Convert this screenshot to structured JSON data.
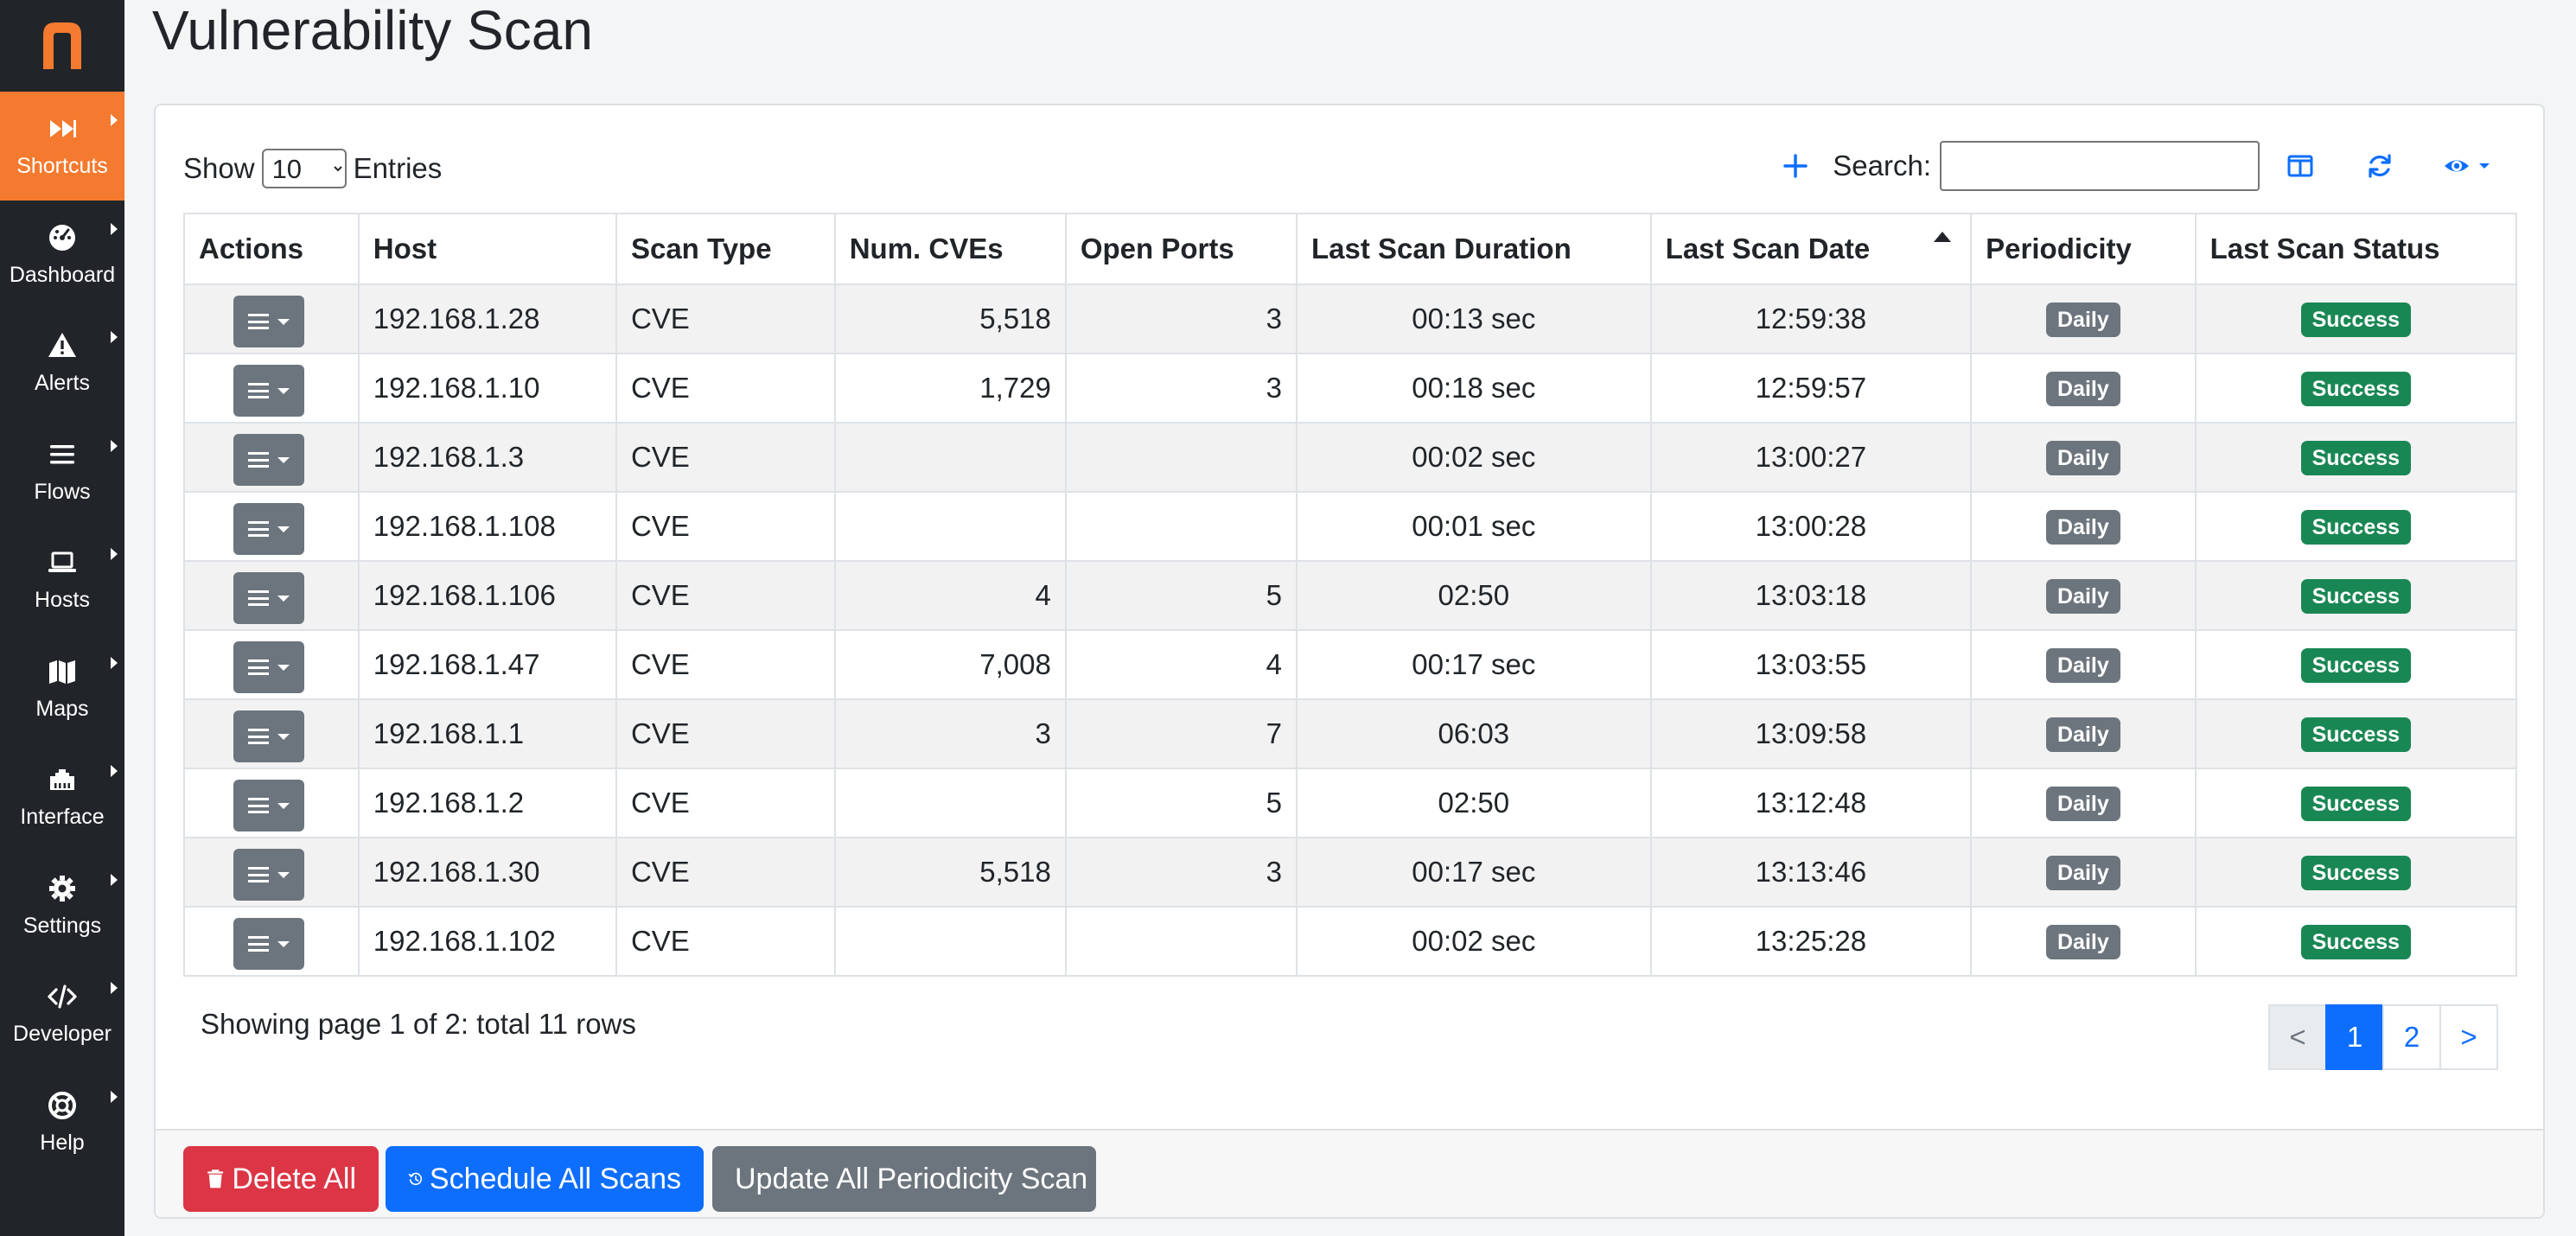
{
  "sidebar": {
    "items": [
      {
        "label": "Shortcuts",
        "icon": "fast-forward-icon",
        "active": true
      },
      {
        "label": "Dashboard",
        "icon": "gauge-icon"
      },
      {
        "label": "Alerts",
        "icon": "warning-icon"
      },
      {
        "label": "Flows",
        "icon": "list-icon"
      },
      {
        "label": "Hosts",
        "icon": "laptop-icon"
      },
      {
        "label": "Maps",
        "icon": "map-icon"
      },
      {
        "label": "Interface",
        "icon": "ethernet-icon"
      },
      {
        "label": "Settings",
        "icon": "gear-icon"
      },
      {
        "label": "Developer",
        "icon": "code-icon"
      },
      {
        "label": "Help",
        "icon": "life-ring-icon"
      }
    ]
  },
  "page": {
    "title": "Vulnerability Scan"
  },
  "controls": {
    "show_label": "Show",
    "entries_value": "10",
    "entries_label": "Entries",
    "search_label": "Search:",
    "search_value": ""
  },
  "table": {
    "headers": [
      "Actions",
      "Host",
      "Scan Type",
      "Num. CVEs",
      "Open Ports",
      "Last Scan Duration",
      "Last Scan Date",
      "Periodicity",
      "Last Scan Status"
    ],
    "rows": [
      {
        "host": "192.168.1.28",
        "scan_type": "CVE",
        "num_cves": "5,518",
        "open_ports": "3",
        "duration": "00:13 sec",
        "date": "12:59:38",
        "periodicity": "Daily",
        "status": "Success"
      },
      {
        "host": "192.168.1.10",
        "scan_type": "CVE",
        "num_cves": "1,729",
        "open_ports": "3",
        "duration": "00:18 sec",
        "date": "12:59:57",
        "periodicity": "Daily",
        "status": "Success"
      },
      {
        "host": "192.168.1.3",
        "scan_type": "CVE",
        "num_cves": "",
        "open_ports": "",
        "duration": "00:02 sec",
        "date": "13:00:27",
        "periodicity": "Daily",
        "status": "Success"
      },
      {
        "host": "192.168.1.108",
        "scan_type": "CVE",
        "num_cves": "",
        "open_ports": "",
        "duration": "00:01 sec",
        "date": "13:00:28",
        "periodicity": "Daily",
        "status": "Success"
      },
      {
        "host": "192.168.1.106",
        "scan_type": "CVE",
        "num_cves": "4",
        "open_ports": "5",
        "duration": "02:50",
        "date": "13:03:18",
        "periodicity": "Daily",
        "status": "Success"
      },
      {
        "host": "192.168.1.47",
        "scan_type": "CVE",
        "num_cves": "7,008",
        "open_ports": "4",
        "duration": "00:17 sec",
        "date": "13:03:55",
        "periodicity": "Daily",
        "status": "Success"
      },
      {
        "host": "192.168.1.1",
        "scan_type": "CVE",
        "num_cves": "3",
        "open_ports": "7",
        "duration": "06:03",
        "date": "13:09:58",
        "periodicity": "Daily",
        "status": "Success"
      },
      {
        "host": "192.168.1.2",
        "scan_type": "CVE",
        "num_cves": "",
        "open_ports": "5",
        "duration": "02:50",
        "date": "13:12:48",
        "periodicity": "Daily",
        "status": "Success"
      },
      {
        "host": "192.168.1.30",
        "scan_type": "CVE",
        "num_cves": "5,518",
        "open_ports": "3",
        "duration": "00:17 sec",
        "date": "13:13:46",
        "periodicity": "Daily",
        "status": "Success"
      },
      {
        "host": "192.168.1.102",
        "scan_type": "CVE",
        "num_cves": "",
        "open_ports": "",
        "duration": "00:02 sec",
        "date": "13:25:28",
        "periodicity": "Daily",
        "status": "Success"
      }
    ]
  },
  "footer": {
    "info": "Showing page 1 of 2: total 11 rows",
    "pagination": [
      "<",
      "1",
      "2",
      ">"
    ],
    "current_page": "1",
    "buttons": {
      "delete_all": "Delete All",
      "schedule_all": "Schedule All Scans",
      "update_periodicity": "Update All Periodicity Scan"
    }
  },
  "colors": {
    "sidebar_bg": "#212529",
    "accent": "#f47a2f",
    "primary": "#0d6efd",
    "danger": "#dc3545",
    "secondary": "#6c757d",
    "success": "#198754"
  }
}
